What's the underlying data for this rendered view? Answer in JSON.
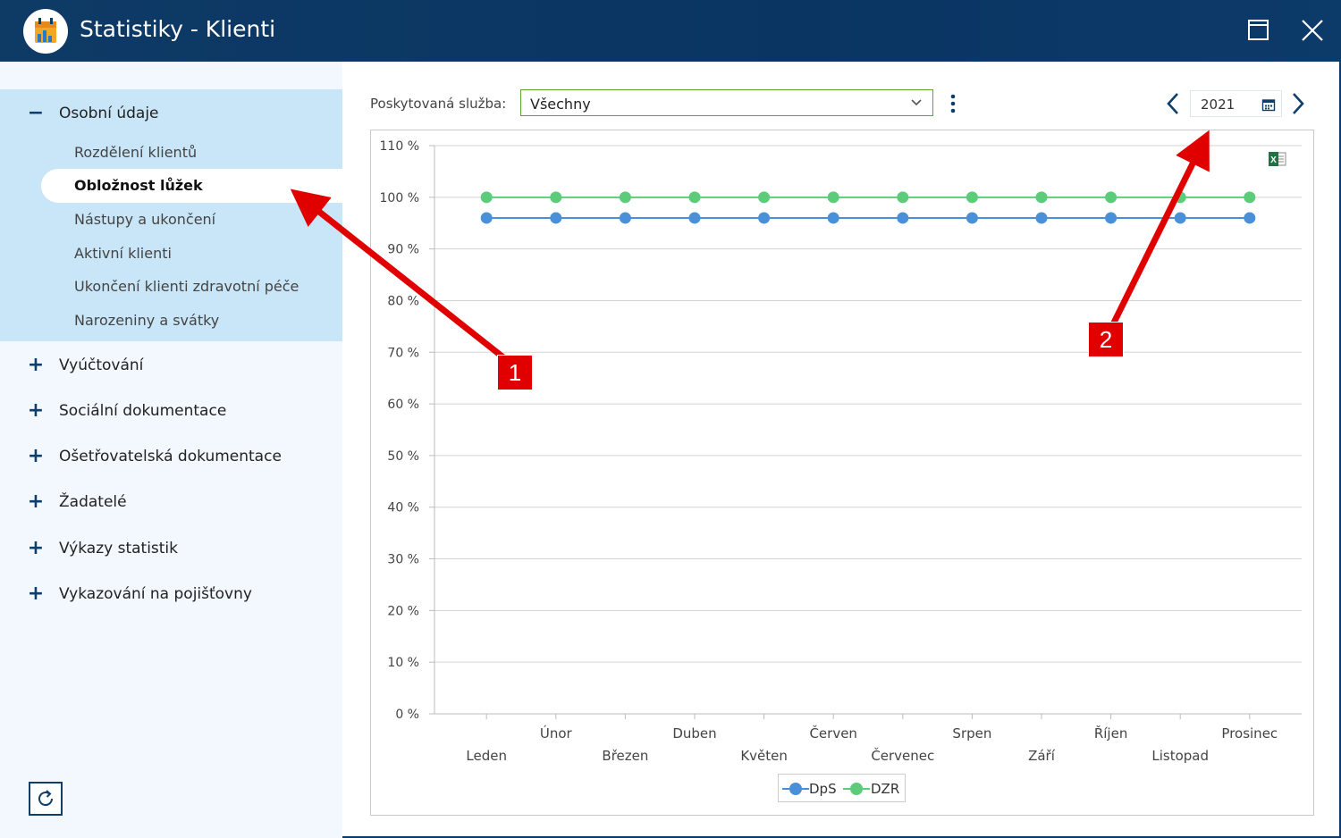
{
  "window": {
    "title": "Statistiky - Klienti"
  },
  "sidebar": {
    "groups": [
      {
        "label": "Osobní údaje",
        "expanded": true,
        "sign": "−"
      },
      {
        "label": "Vyúčtování",
        "sign": "+"
      },
      {
        "label": "Sociální dokumentace",
        "sign": "+"
      },
      {
        "label": "Ošetřovatelská dokumentace",
        "sign": "+"
      },
      {
        "label": "Žadatelé",
        "sign": "+"
      },
      {
        "label": "Výkazy statistik",
        "sign": "+"
      },
      {
        "label": "Vykazování na pojišťovny",
        "sign": "+"
      }
    ],
    "subitems": [
      "Rozdělení klientů",
      "Obložnost lůžek",
      "Nástupy a ukončení",
      "Aktivní klienti",
      "Ukončení klienti zdravotní péče",
      "Narozeniny a svátky"
    ],
    "active_subitem": "Obložnost lůžek"
  },
  "filter": {
    "label": "Poskytovaná služba:",
    "value": "Všechny"
  },
  "year": "2021",
  "callouts": [
    "1",
    "2"
  ],
  "colors": {
    "dps": "#4a90d9",
    "dzr": "#5dcc7a",
    "titlebar": "#0c3a69",
    "callout": "#e00000"
  },
  "icons": [
    "app-logo-icon",
    "maximize-icon",
    "close-icon",
    "chevron-down-icon",
    "more-vert-icon",
    "chevron-left-icon",
    "calendar-icon",
    "chevron-right-icon",
    "excel-export-icon",
    "refresh-icon"
  ],
  "chart_data": {
    "type": "line",
    "categories": [
      "Leden",
      "Únor",
      "Březen",
      "Duben",
      "Květen",
      "Červen",
      "Červenec",
      "Srpen",
      "Září",
      "Říjen",
      "Listopad",
      "Prosinec"
    ],
    "series": [
      {
        "name": "DpS",
        "values": [
          96,
          96,
          96,
          96,
          96,
          96,
          96,
          96,
          96,
          96,
          96,
          96
        ],
        "color": "#4a90d9"
      },
      {
        "name": "DZR",
        "values": [
          100,
          100,
          100,
          100,
          100,
          100,
          100,
          100,
          100,
          100,
          100,
          100
        ],
        "color": "#5dcc7a"
      }
    ],
    "y_ticks": [
      "0 %",
      "10 %",
      "20 %",
      "30 %",
      "40 %",
      "50 %",
      "60 %",
      "70 %",
      "80 %",
      "90 %",
      "100 %",
      "110 %"
    ],
    "ylim": [
      0,
      110
    ],
    "grid": true,
    "legend": "bottom"
  }
}
